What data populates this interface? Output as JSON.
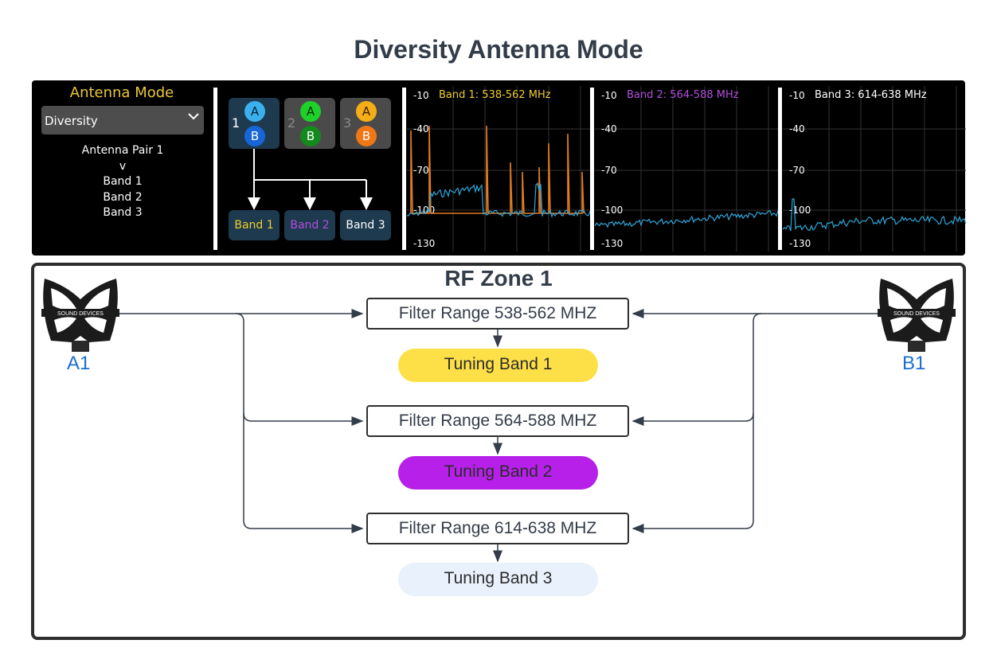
{
  "title": "Diversity Antenna Mode",
  "panel": {
    "mode_title": "Antenna Mode",
    "mode_value": "Diversity",
    "info_lines": [
      "Antenna Pair 1",
      "v",
      "Band 1",
      "Band 2",
      "Band 3"
    ],
    "pairs": [
      {
        "num": "1",
        "a": "A",
        "b": "B"
      },
      {
        "num": "2",
        "a": "A",
        "b": "B"
      },
      {
        "num": "3",
        "a": "A",
        "b": "B"
      }
    ],
    "bands": [
      "Band 1",
      "Band 2",
      "Band 3"
    ],
    "colors": {
      "band1": "#f0cd2e",
      "band2": "#b44ee0",
      "band3": "#ffffff",
      "spectrum": "#2ea6d9",
      "peaks": "#e07b22"
    },
    "spectra": [
      {
        "label": "Band 1: 538-562 MHz",
        "ticks": [
          "-10",
          "-40",
          "-70",
          "-100",
          "-130"
        ]
      },
      {
        "label": "Band 2: 564-588 MHz",
        "ticks": [
          "-10",
          "-40",
          "-70",
          "-100",
          "-130"
        ]
      },
      {
        "label": "Band 3: 614-638 MHz",
        "ticks": [
          "-10",
          "-40",
          "-70",
          "-100",
          "-130"
        ]
      }
    ]
  },
  "zone": {
    "title": "RF Zone 1",
    "filters": [
      "Filter Range 538-562 MHZ",
      "Filter Range 564-588 MHZ",
      "Filter Range 614-638 MHZ"
    ],
    "tuning": [
      "Tuning Band 1",
      "Tuning Band 2",
      "Tuning Band 3"
    ],
    "tuning_colors": [
      "#fde047",
      "#b620e8",
      "#e8f1fc"
    ],
    "antenna_left": "A1",
    "antenna_right": "B1",
    "antenna_brand": "SOUND DEVICES"
  }
}
